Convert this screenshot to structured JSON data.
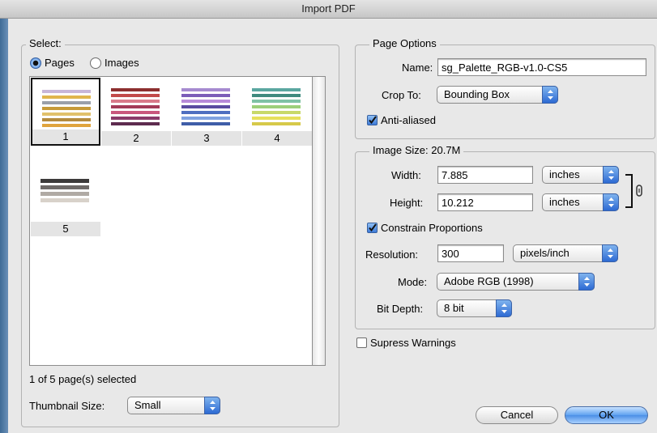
{
  "window": {
    "title": "Import PDF"
  },
  "select": {
    "legend": "Select:",
    "radio_pages": "Pages",
    "radio_images": "Images",
    "pages": [
      "1",
      "2",
      "3",
      "4",
      "5"
    ],
    "status": "1 of 5 page(s) selected",
    "thumb_size_label": "Thumbnail Size:",
    "thumb_size_value": "Small"
  },
  "page_options": {
    "legend": "Page Options",
    "name_label": "Name:",
    "name_value": "sg_Palette_RGB-v1.0-CS5",
    "crop_label": "Crop To:",
    "crop_value": "Bounding Box",
    "antialias_label": "Anti-aliased"
  },
  "image_size": {
    "legend": "Image Size: 20.7M",
    "width_label": "Width:",
    "width_value": "7.885",
    "width_unit": "inches",
    "height_label": "Height:",
    "height_value": "10.212",
    "height_unit": "inches",
    "constrain_label": "Constrain Proportions",
    "resolution_label": "Resolution:",
    "resolution_value": "300",
    "resolution_unit": "pixels/inch",
    "mode_label": "Mode:",
    "mode_value": "Adobe RGB (1998)",
    "bitdepth_label": "Bit Depth:",
    "bitdepth_value": "8 bit"
  },
  "suppress_label": "Supress Warnings",
  "buttons": {
    "cancel": "Cancel",
    "ok": "OK"
  },
  "colors": {
    "accent": "#4b8fe6"
  }
}
